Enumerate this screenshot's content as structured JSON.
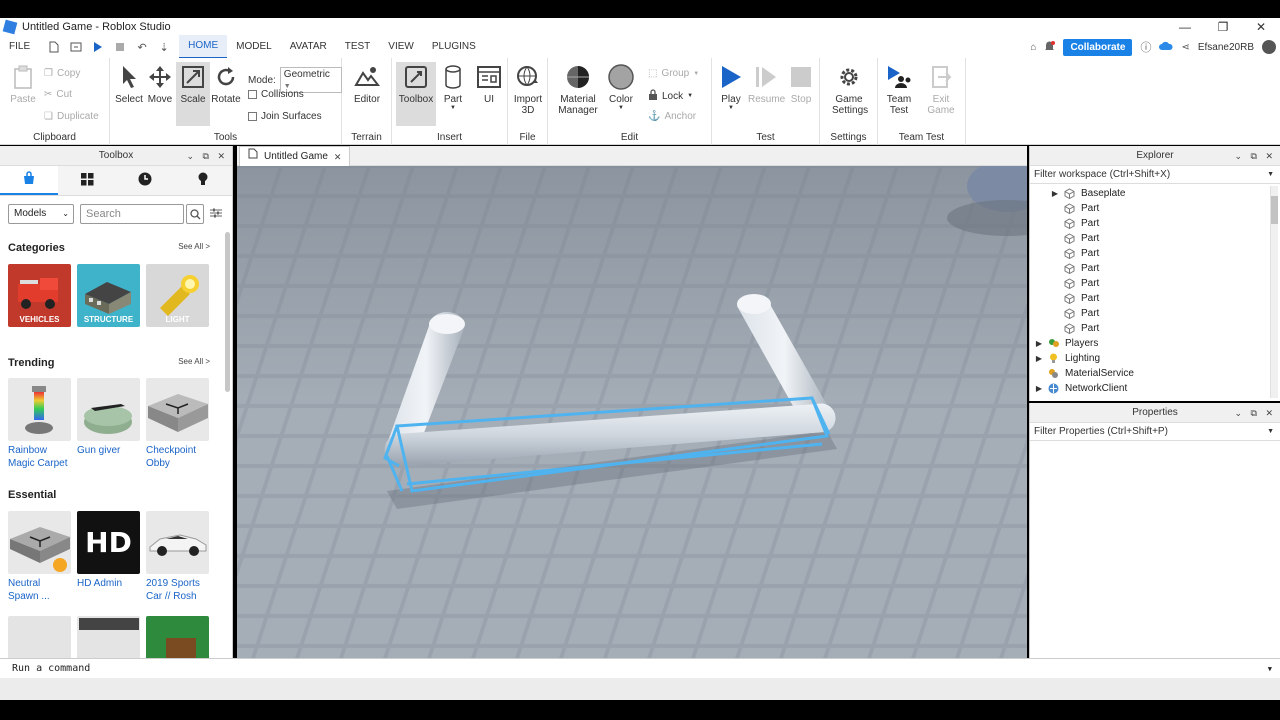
{
  "window": {
    "title": "Untitled Game - Roblox Studio",
    "controls": [
      "—",
      "❐",
      "✕"
    ]
  },
  "menubar": {
    "file": "FILE",
    "tabs": [
      "HOME",
      "MODEL",
      "AVATAR",
      "TEST",
      "VIEW",
      "PLUGINS"
    ],
    "active_tab": "HOME",
    "collaborate": "Collaborate",
    "user": "Efsane20RB"
  },
  "ribbon": {
    "clipboard": {
      "label": "Clipboard",
      "paste": "Paste",
      "copy": "Copy",
      "cut": "Cut",
      "duplicate": "Duplicate"
    },
    "tools": {
      "label": "Tools",
      "select": "Select",
      "move": "Move",
      "scale": "Scale",
      "rotate": "Rotate",
      "mode_label": "Mode:",
      "mode_value": "Geometric",
      "collisions": "Collisions",
      "join_surfaces": "Join Surfaces"
    },
    "terrain": {
      "label": "Terrain",
      "editor": "Editor"
    },
    "insert": {
      "label": "Insert",
      "toolbox": "Toolbox",
      "part": "Part",
      "ui": "UI"
    },
    "file": {
      "label": "File",
      "import3d_1": "Import",
      "import3d_2": "3D"
    },
    "edit": {
      "label": "Edit",
      "material_1": "Material",
      "material_2": "Manager",
      "color": "Color",
      "group": "Group",
      "lock": "Lock",
      "anchor": "Anchor"
    },
    "test": {
      "label": "Test",
      "play": "Play",
      "resume": "Resume",
      "stop": "Stop"
    },
    "settings": {
      "label": "Settings",
      "game_1": "Game",
      "game_2": "Settings"
    },
    "teamtest": {
      "label": "Team Test",
      "team_1": "Team",
      "team_2": "Test",
      "exit_1": "Exit",
      "exit_2": "Game"
    }
  },
  "toolbox": {
    "title": "Toolbox",
    "category_select": "Models",
    "search_placeholder": "Search",
    "sections": {
      "categories": {
        "title": "Categories",
        "see_all": "See All >",
        "items": [
          "VEHICLES",
          "STRUCTURE",
          "LIGHT"
        ]
      },
      "trending": {
        "title": "Trending",
        "see_all": "See All >",
        "items": [
          [
            "Rainbow",
            "Magic Carpet"
          ],
          [
            "Gun giver",
            ""
          ],
          [
            "Checkpoint",
            "Obby"
          ]
        ]
      },
      "essential": {
        "title": "Essential",
        "items": [
          [
            "Neutral",
            "Spawn ..."
          ],
          [
            "HD Admin",
            ""
          ],
          [
            "2019 Sports",
            "Car // Rosh"
          ]
        ]
      }
    },
    "hd_logo": "HD"
  },
  "viewport": {
    "tab_title": "Untitled Game",
    "close": "✕"
  },
  "explorer": {
    "title": "Explorer",
    "filter": "Filter workspace (Ctrl+Shift+X)",
    "items": [
      {
        "label": "Baseplate",
        "indent": 2,
        "arrow": "▶"
      },
      {
        "label": "Part",
        "indent": 2,
        "arrow": ""
      },
      {
        "label": "Part",
        "indent": 2,
        "arrow": ""
      },
      {
        "label": "Part",
        "indent": 2,
        "arrow": ""
      },
      {
        "label": "Part",
        "indent": 2,
        "arrow": ""
      },
      {
        "label": "Part",
        "indent": 2,
        "arrow": ""
      },
      {
        "label": "Part",
        "indent": 2,
        "arrow": ""
      },
      {
        "label": "Part",
        "indent": 2,
        "arrow": ""
      },
      {
        "label": "Part",
        "indent": 2,
        "arrow": ""
      },
      {
        "label": "Part",
        "indent": 2,
        "arrow": ""
      },
      {
        "label": "Players",
        "indent": 1,
        "arrow": "▶"
      },
      {
        "label": "Lighting",
        "indent": 1,
        "arrow": "▶"
      },
      {
        "label": "MaterialService",
        "indent": 1,
        "arrow": ""
      },
      {
        "label": "NetworkClient",
        "indent": 1,
        "arrow": "▶"
      }
    ]
  },
  "properties": {
    "title": "Properties",
    "filter": "Filter Properties (Ctrl+Shift+P)"
  },
  "command_bar": {
    "placeholder": "Run a command"
  },
  "colors": {
    "accent": "#1a82e6",
    "selection": "#4fb3f0"
  }
}
